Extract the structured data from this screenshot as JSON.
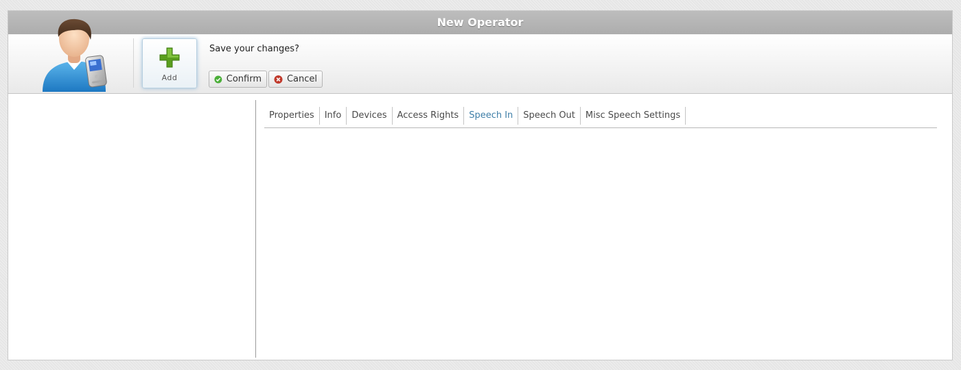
{
  "window": {
    "title": "New Operator"
  },
  "toolbar": {
    "add_label": "Add",
    "prompt": "Save your changes?",
    "confirm_label": "Confirm",
    "cancel_label": "Cancel"
  },
  "tabs": [
    {
      "label": "Properties",
      "active": false
    },
    {
      "label": "Info",
      "active": false
    },
    {
      "label": "Devices",
      "active": false
    },
    {
      "label": "Access Rights",
      "active": false
    },
    {
      "label": "Speech In",
      "active": true
    },
    {
      "label": "Speech Out",
      "active": false
    },
    {
      "label": "Misc Speech Settings",
      "active": false
    }
  ],
  "colors": {
    "active_tab": "#3f7fa8",
    "confirm_icon": "#4caf3a",
    "cancel_icon": "#c0392b",
    "add_plus": "#5a9e1e"
  },
  "icons": {
    "avatar": "operator-with-phone-icon",
    "add": "plus-icon",
    "confirm": "check-circle-icon",
    "cancel": "x-circle-icon"
  }
}
